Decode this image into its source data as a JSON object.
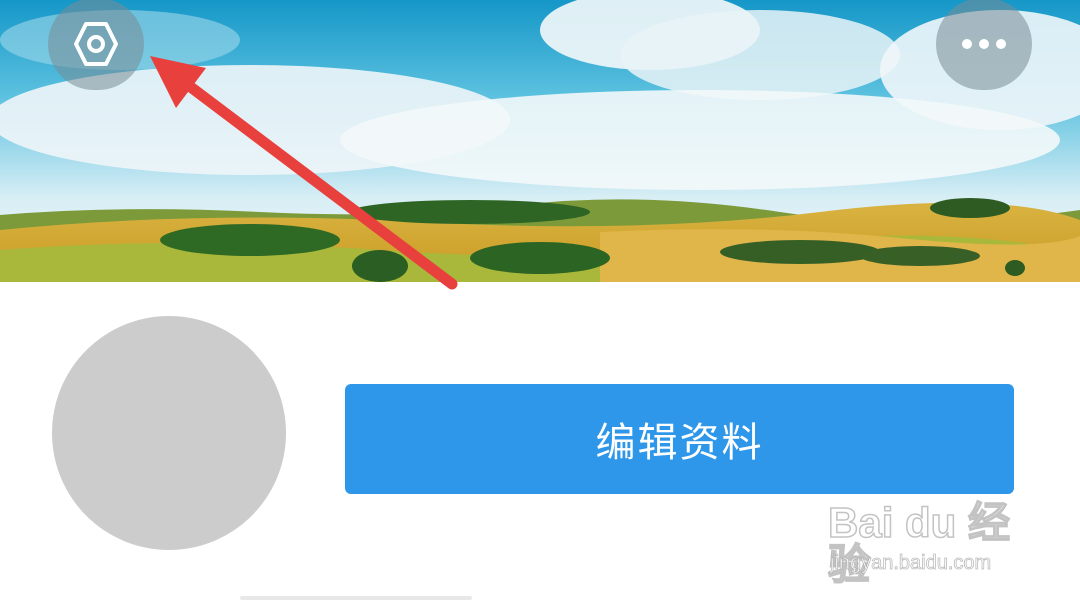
{
  "header": {
    "settings_icon": "settings-hexagon-icon",
    "more_icon": "more-dots-icon"
  },
  "profile": {
    "edit_button_label": "编辑资料"
  },
  "watermark": {
    "brand": "Bai du 经验",
    "url": "jingyan.baidu.com"
  },
  "colors": {
    "button_blue": "#2f97ea",
    "avatar_gray": "#cccccc",
    "arrow_red": "#e8403c",
    "sky_blue": "#2aa6d6"
  }
}
